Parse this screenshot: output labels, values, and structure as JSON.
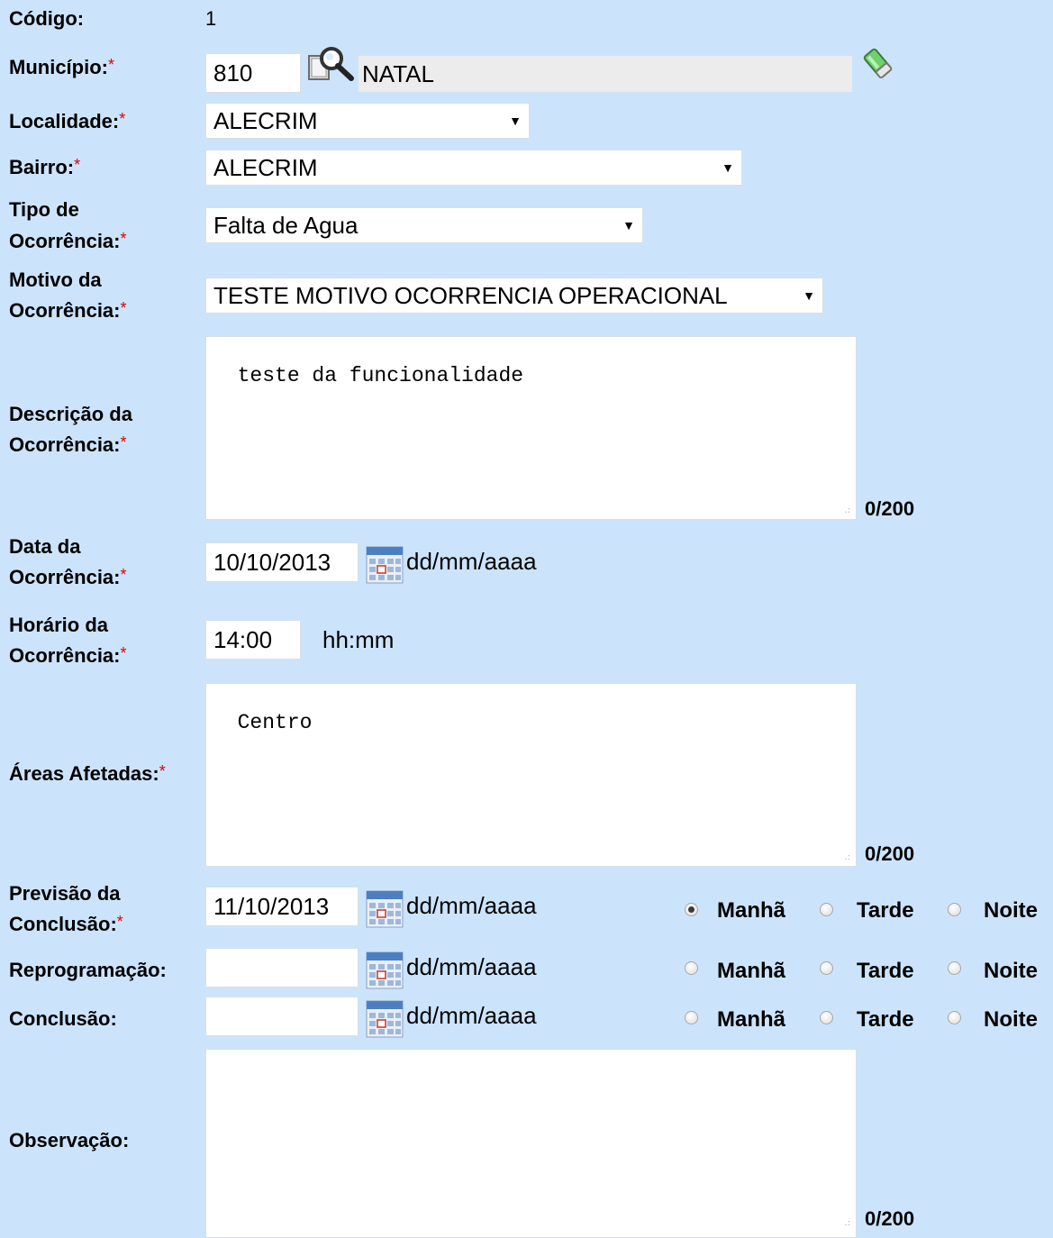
{
  "form": {
    "codigo": {
      "label": "Código:",
      "value": "1"
    },
    "municipio": {
      "label": "Município:",
      "code": "810",
      "name": "NATAL"
    },
    "localidade": {
      "label": "Localidade:",
      "value": "ALECRIM"
    },
    "bairro": {
      "label": "Bairro:",
      "value": "ALECRIM"
    },
    "tipo": {
      "label_line1": "Tipo de",
      "label_line2": "Ocorrência:",
      "value": "Falta de Agua"
    },
    "motivo": {
      "label_line1": "Motivo da",
      "label_line2": "Ocorrência:",
      "value": "TESTE MOTIVO OCORRENCIA OPERACIONAL"
    },
    "descricao": {
      "label_line1": "Descrição da",
      "label_line2": "Ocorrência:",
      "value": "teste da funcionalidade",
      "counter": "0/200"
    },
    "data": {
      "label_line1": "Data da",
      "label_line2": "Ocorrência:",
      "value": "10/10/2013",
      "format": "dd/mm/aaaa"
    },
    "horario": {
      "label_line1": "Horário da",
      "label_line2": "Ocorrência:",
      "value": "14:00",
      "format": "hh:mm"
    },
    "areas": {
      "label": "Áreas Afetadas:",
      "value": "Centro",
      "counter": "0/200"
    },
    "previsao": {
      "label_line1": "Previsão da",
      "label_line2": "Conclusão:",
      "value": "11/10/2013",
      "format": "dd/mm/aaaa",
      "selected_period": "Manhã"
    },
    "reprogramacao": {
      "label": "Reprogramação:",
      "value": "",
      "format": "dd/mm/aaaa",
      "selected_period": ""
    },
    "conclusao": {
      "label": "Conclusão:",
      "value": "",
      "format": "dd/mm/aaaa",
      "selected_period": ""
    },
    "observacao": {
      "label": "Observação:",
      "value": "",
      "counter": "0/200"
    },
    "required_mark": "*",
    "periods": {
      "morning": "Manhã",
      "afternoon": "Tarde",
      "night": "Noite"
    }
  },
  "colors": {
    "background": "#cce4fb",
    "required": "#e00000",
    "readonly_field": "#ececec"
  },
  "icons": {
    "search": "search-magnifier-icon",
    "clear": "eraser-icon",
    "calendar": "calendar-icon"
  }
}
